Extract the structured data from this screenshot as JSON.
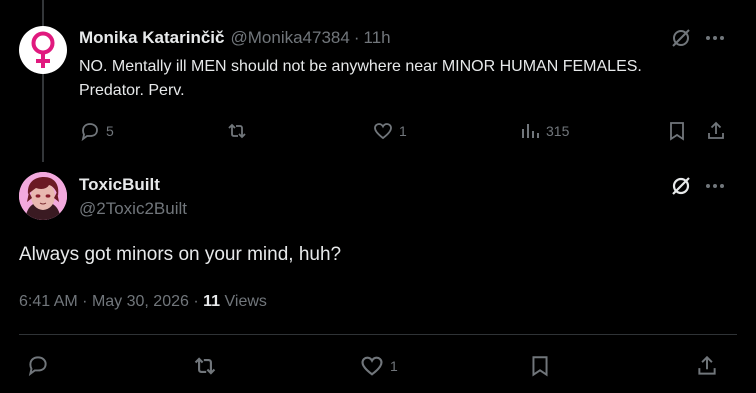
{
  "reply": {
    "display_name": "Monika Katarinčič",
    "handle": "@Monika47384",
    "separator": "·",
    "time": "11h",
    "text": "NO. Mentally ill MEN should not be anywhere near MINOR HUMAN FEMALES. Predator. Perv.",
    "avatar_icon": "female-symbol-icon",
    "actions": {
      "replies": "5",
      "likes": "1",
      "views": "315"
    }
  },
  "main": {
    "display_name": "ToxicBuilt",
    "handle": "@2Toxic2Built",
    "text": "Always got minors on your mind, huh?",
    "time": "6:41 AM",
    "dot1": "·",
    "date": "May 30, 2026",
    "dot2": "·",
    "views_count": "11",
    "views_label": "Views",
    "actions": {
      "likes": "1"
    }
  },
  "colors": {
    "background": "#000000",
    "text": "#e7e9ea",
    "muted": "#71767b",
    "avatar_symbol": "#e0197e"
  }
}
